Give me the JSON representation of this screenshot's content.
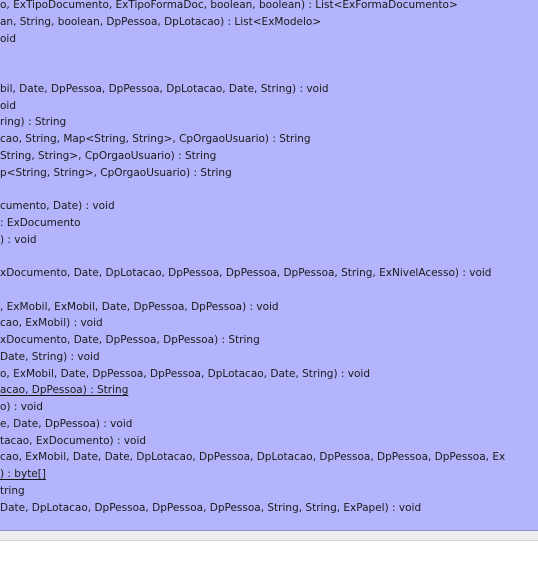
{
  "method_list": {
    "rows": [
      {
        "text": "o, ExTipoDocumento, ExTipoFormaDoc, boolean, boolean) : List<ExFormaDocumento>",
        "link": false
      },
      {
        "text": "an, String, boolean, DpPessoa, DpLotacao) : List<ExModelo>",
        "link": false
      },
      {
        "text": "oid",
        "link": false
      },
      {
        "text": "",
        "link": false
      },
      {
        "text": "",
        "link": false
      },
      {
        "text": "bil, Date, DpPessoa, DpPessoa, DpLotacao, Date, String) : void",
        "link": false
      },
      {
        "text": "oid",
        "link": false
      },
      {
        "text": "ring) : String",
        "link": false
      },
      {
        "text": "cao, String, Map<String, String>, CpOrgaoUsuario) : String",
        "link": false
      },
      {
        "text": "String, String>, CpOrgaoUsuario) : String",
        "link": false
      },
      {
        "text": "p<String, String>, CpOrgaoUsuario) : String",
        "link": false
      },
      {
        "text": "",
        "link": false
      },
      {
        "text": "cumento, Date) : void",
        "link": false
      },
      {
        "text": ": ExDocumento",
        "link": false
      },
      {
        "text": ") : void",
        "link": false
      },
      {
        "text": "",
        "link": false
      },
      {
        "text": "xDocumento, Date, DpLotacao, DpPessoa, DpPessoa, DpPessoa, String, ExNivelAcesso) : void",
        "link": false
      },
      {
        "text": "",
        "link": false
      },
      {
        "text": ", ExMobil, ExMobil, Date, DpPessoa, DpPessoa) : void",
        "link": false
      },
      {
        "text": "cao, ExMobil) : void",
        "link": false
      },
      {
        "text": "xDocumento, Date, DpPessoa, DpPessoa) : String",
        "link": false
      },
      {
        "text": "Date, String) : void",
        "link": false
      },
      {
        "text": "o, ExMobil, Date, DpPessoa, DpPessoa, DpLotacao, Date, String) : void",
        "link": false
      },
      {
        "text": "acao, DpPessoa) : String",
        "link": true
      },
      {
        "text": "o) : void",
        "link": false
      },
      {
        "text": "e, Date, DpPessoa) : void",
        "link": false
      },
      {
        "text": "tacao, ExDocumento) : void",
        "link": false
      },
      {
        "text": "cao, ExMobil, Date, Date, DpLotacao, DpPessoa, DpLotacao, DpPessoa, DpPessoa, DpPessoa, Ex",
        "link": false
      },
      {
        "text": ") : byte[]",
        "link": true
      },
      {
        "text": "tring",
        "link": false
      },
      {
        "text": " Date, DpLotacao, DpPessoa, DpPessoa, DpPessoa, String, String, ExPapel) : void",
        "link": false
      }
    ]
  },
  "colors": {
    "panel_background": "#b4b4fc",
    "text": "#1a1a1a"
  }
}
